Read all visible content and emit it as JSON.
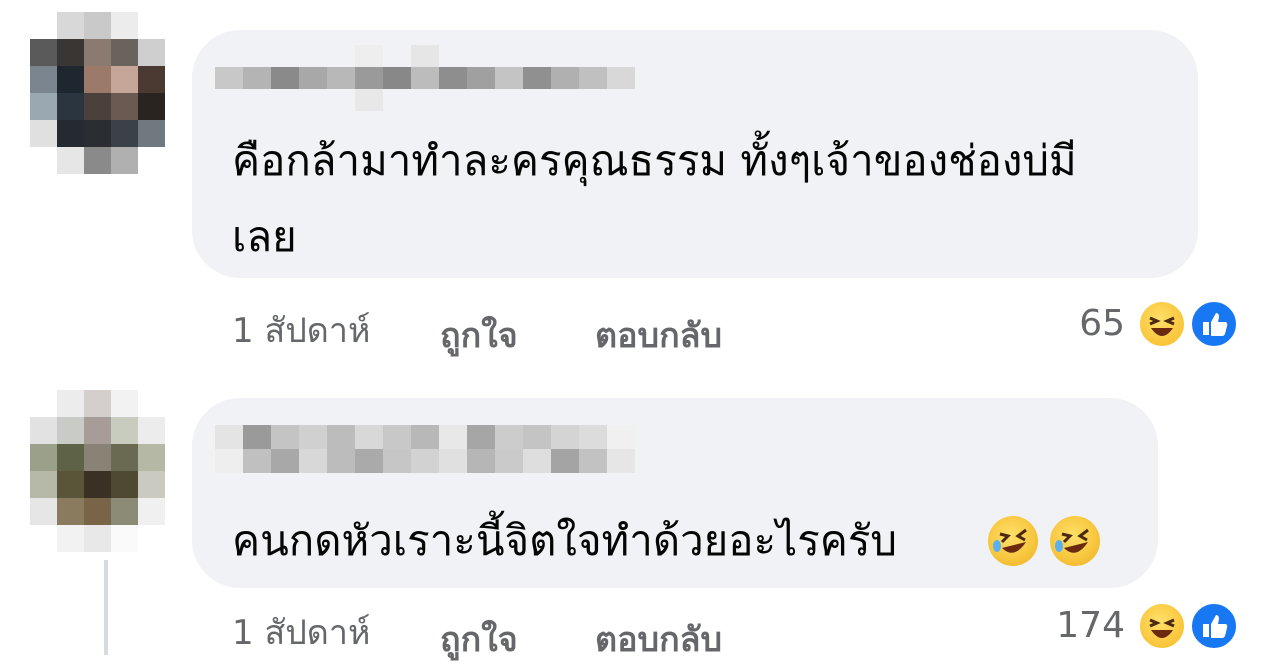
{
  "comments": [
    {
      "text": "คือกล้ามาทำละครคุณธรรม ทั้งๆเจ้าของช่องบ่มีเลย",
      "line1": "คือกล้ามาทำละครคุณธรรม ทั้งๆเจ้าของช่องบ่มี",
      "line2": "เลย",
      "time": "1 สัปดาห์",
      "like_label": "ถูกใจ",
      "reply_label": "ตอบกลับ",
      "reaction_count": "65",
      "reactions": [
        "laughing-emoji",
        "like-thumb"
      ]
    },
    {
      "text": "คนกดหัวเราะนี้จิตใจทำด้วยอะไรครับ",
      "emojis": [
        "rofl-emoji",
        "rofl-emoji"
      ],
      "time": "1 สัปดาห์",
      "like_label": "ถูกใจ",
      "reply_label": "ตอบกลับ",
      "reaction_count": "174",
      "reactions": [
        "laughing-emoji",
        "like-thumb"
      ]
    }
  ],
  "colors": {
    "bubble": "#f0f2f5",
    "meta_text": "#65676b",
    "like_blue": "#1877f2",
    "haha_yellow": "#f7c53c"
  }
}
